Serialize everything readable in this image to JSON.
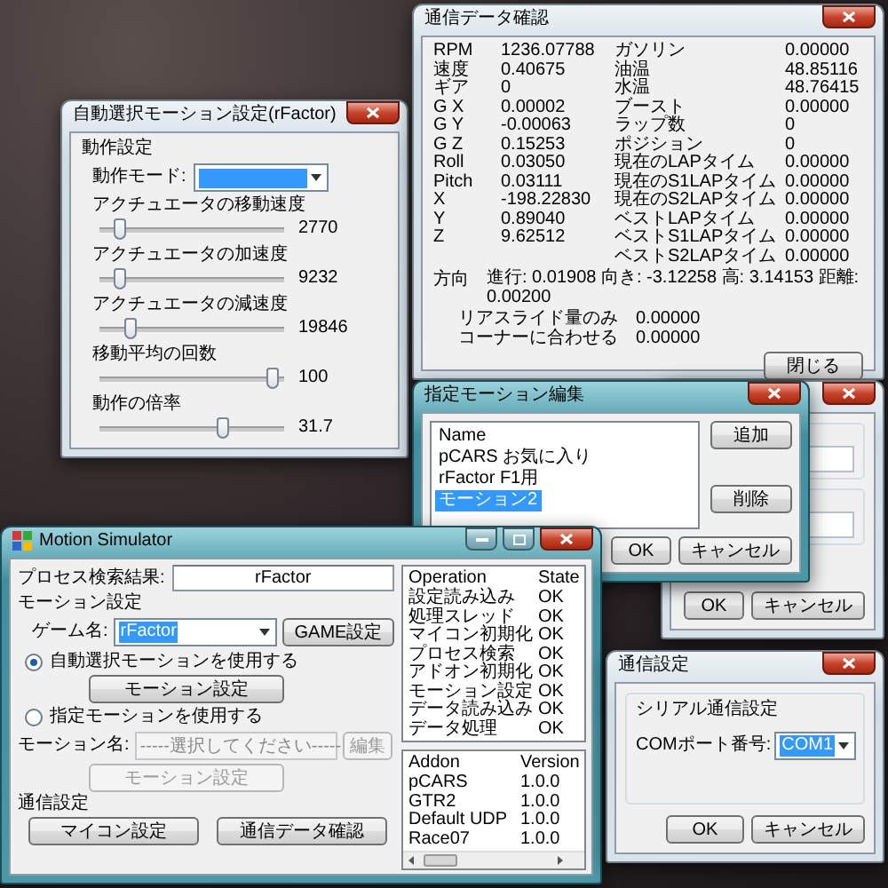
{
  "slider_window": {
    "title": "自動選択モーション設定(rFactor)",
    "active": false,
    "group_title": "動作設定",
    "mode_label": "動作モード:",
    "sliders": [
      {
        "label": "アクチュエータの移動速度",
        "value": "2770",
        "level": 0.08
      },
      {
        "label": "アクチュエータの加速度",
        "value": "9232",
        "level": 0.08
      },
      {
        "label": "アクチュエータの減速度",
        "value": "19846",
        "level": 0.14
      },
      {
        "label": "移動平均の回数",
        "value": "100",
        "level": 0.97
      },
      {
        "label": "動作の倍率",
        "value": "31.7",
        "level": 0.68
      }
    ]
  },
  "telemetry_window": {
    "title": "通信データ確認",
    "active": false,
    "rows": [
      {
        "label": "RPM",
        "value": "1236.07788",
        "label_2": "ガソリン",
        "value_2": "0.00000"
      },
      {
        "label": "速度",
        "value": "0.40675",
        "label_2": "油温",
        "value_2": "48.85116"
      },
      {
        "label": "ギア",
        "value": "0",
        "label_2": "水温",
        "value_2": "48.76415"
      },
      {
        "label": "G X",
        "value": "0.00002",
        "label_2": "ブースト",
        "value_2": "0.00000"
      },
      {
        "label": "G Y",
        "value": "-0.00063",
        "label_2": "ラップ数",
        "value_2": "0"
      },
      {
        "label": "G Z",
        "value": "0.15253",
        "label_2": "ポジション",
        "value_2": "0"
      },
      {
        "label": "Roll",
        "value": "0.03050",
        "label_2": "現在のLAPタイム",
        "value_2": "0.00000"
      },
      {
        "label": "Pitch",
        "value": "0.03111",
        "label_2": "現在のS1LAPタイム",
        "value_2": "0.00000"
      },
      {
        "label": "X",
        "value": "-198.22830",
        "label_2": "現在のS2LAPタイム",
        "value_2": "0.00000"
      },
      {
        "label": "Y",
        "value": "0.89040",
        "label_2": "ベストLAPタイム",
        "value_2": "0.00000"
      },
      {
        "label": "Z",
        "value": "9.62512",
        "label_2": "ベストS1LAPタイム",
        "value_2": "0.00000"
      },
      {
        "label_2": "ベストS2LAPタイム",
        "value_2": "0.00000"
      }
    ],
    "direction": {
      "label": "方向",
      "text": "進行: 0.01908 向き: -3.12258 高: 3.14153 距離: 0.00200"
    },
    "extra_rows": [
      {
        "label": "リアスライド量のみ",
        "value": "0.00000"
      },
      {
        "label": "コーナーに合わせる",
        "value": "0.00000"
      }
    ],
    "close_button": "閉じる"
  },
  "settings_window": {
    "active": false,
    "buttons": [
      "OK",
      "キャンセル"
    ]
  },
  "motion_edit_dialog": {
    "title": "指定モーション編集",
    "active": true,
    "list_header": "Name",
    "items": [
      {
        "label": "pCARS お気に入り",
        "selected": false
      },
      {
        "label": "rFactor F1用",
        "selected": false
      },
      {
        "label": "モーション2",
        "selected": true
      }
    ],
    "side_buttons": [
      "追加",
      "削除"
    ],
    "buttons": [
      "OK",
      "キャンセル"
    ]
  },
  "main_window": {
    "title": "Motion Simulator",
    "active": true,
    "process_label": "プロセス検索結果:",
    "process_value": "rFactor",
    "motion_group": "モーション設定",
    "game_label": "ゲーム名:",
    "game_value": "rFactor",
    "game_button": "GAME設定",
    "options": [
      {
        "label": "自動選択モーションを使用する",
        "selected": true
      },
      {
        "label": "指定モーションを使用する",
        "selected": false
      }
    ],
    "auto_button": {
      "label": "モーション設定",
      "disabled": false
    },
    "motion_label": "モーション名:",
    "motion_dropdown": {
      "placeholder": "-----選択してください-----",
      "disabled": true
    },
    "edit_button": {
      "label": "編集",
      "disabled": true
    },
    "manual_button": {
      "label": "モーション設定",
      "disabled": true
    },
    "comm_group": "通信設定",
    "buttons": [
      "マイコン設定",
      "通信データ確認"
    ],
    "operations": {
      "columns": [
        "Operation",
        "State"
      ],
      "rows": [
        [
          "設定読み込み",
          "OK"
        ],
        [
          "処理スレッド",
          "OK"
        ],
        [
          "マイコン初期化",
          "OK"
        ],
        [
          "プロセス検索",
          "OK"
        ],
        [
          "アドオン初期化",
          "OK"
        ],
        [
          "モーション設定",
          "OK"
        ],
        [
          "データ読み込み",
          "OK"
        ],
        [
          "データ処理",
          "OK"
        ]
      ]
    },
    "addons": {
      "columns": [
        "Addon",
        "Version"
      ],
      "rows": [
        [
          "pCARS",
          "1.0.0"
        ],
        [
          "GTR2",
          "1.0.0"
        ],
        [
          "Default UDP",
          "1.0.0"
        ],
        [
          "Race07",
          "1.0.0"
        ]
      ]
    }
  },
  "serial_window": {
    "title": "通信設定",
    "active": false,
    "group_title": "シリアル通信設定",
    "port_label": "COMポート番号:",
    "port_value": "COM1",
    "buttons": [
      "OK",
      "キャンセル"
    ]
  }
}
